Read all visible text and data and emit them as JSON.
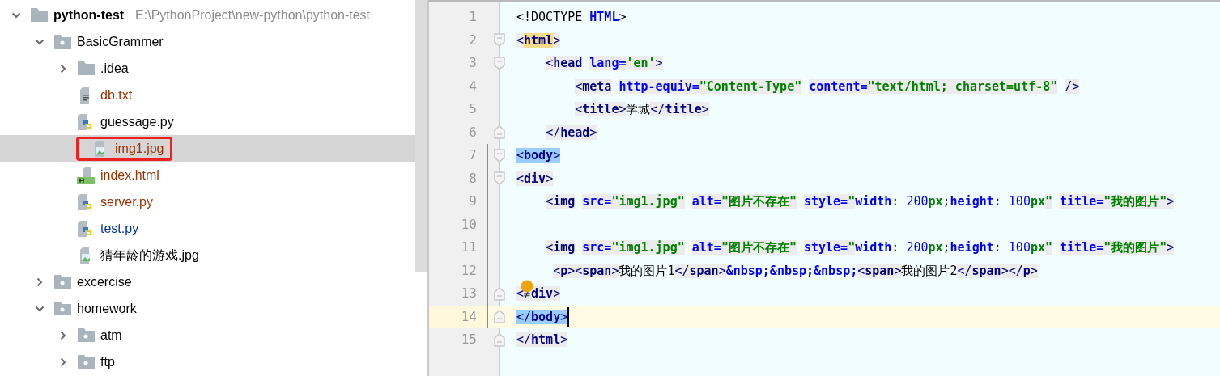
{
  "project_tree": {
    "items": [
      {
        "label": "python-test",
        "kind": "project",
        "path": "E:\\PythonProject\\new-python\\python-test",
        "expanded": true,
        "selected": false,
        "annotated": false,
        "children": [
          {
            "label": "BasicGrammer",
            "kind": "module",
            "expanded": true,
            "selected": false,
            "annotated": false,
            "children": [
              {
                "label": ".idea",
                "kind": "folder",
                "expanded": false,
                "selected": false,
                "annotated": false
              },
              {
                "label": "db.txt",
                "kind": "text",
                "color": "#993300",
                "selected": false,
                "annotated": false
              },
              {
                "label": "guessage.py",
                "kind": "python",
                "color": "#000000",
                "selected": false,
                "annotated": false
              },
              {
                "label": "img1.jpg",
                "kind": "image",
                "color": "#993300",
                "selected": true,
                "annotated": true
              },
              {
                "label": "index.html",
                "kind": "html",
                "color": "#993300",
                "selected": false,
                "annotated": false
              },
              {
                "label": "server.py",
                "kind": "python",
                "color": "#993300",
                "selected": false,
                "annotated": false
              },
              {
                "label": "test.py",
                "kind": "python",
                "color": "#0032a0",
                "selected": false,
                "annotated": false
              },
              {
                "label": "猜年龄的游戏.jpg",
                "kind": "image",
                "color": "#000000",
                "selected": false,
                "annotated": false
              }
            ]
          },
          {
            "label": "excercise",
            "kind": "module",
            "expanded": false,
            "selected": false,
            "annotated": false
          },
          {
            "label": "homework",
            "kind": "module",
            "expanded": true,
            "selected": false,
            "annotated": false,
            "children": [
              {
                "label": "atm",
                "kind": "module",
                "expanded": false,
                "selected": false,
                "annotated": false
              },
              {
                "label": "ftp",
                "kind": "module",
                "expanded": false,
                "selected": false,
                "annotated": false
              }
            ]
          }
        ]
      }
    ]
  },
  "editor": {
    "lines": [
      {
        "number": "1",
        "modified": false,
        "current": false,
        "tokens": [
          {
            "kind": "doctype",
            "text": "<!DOCTYPE "
          },
          {
            "kind": "keyword",
            "text": "HTML"
          },
          {
            "kind": "doctype",
            "text": ">"
          }
        ]
      },
      {
        "number": "2",
        "fold_marker": {
          "kind": "start"
        },
        "modified": false,
        "current": false,
        "tokens": [
          {
            "kind": "bracket",
            "text": "<"
          },
          {
            "kind": "tag",
            "text": "html",
            "matched": true
          },
          {
            "kind": "bracket",
            "text": ">"
          }
        ]
      },
      {
        "number": "3",
        "fold_marker": {
          "kind": "start"
        },
        "modified": false,
        "current": false,
        "tokens": [
          {
            "kind": "bracket",
            "text": "    <"
          },
          {
            "kind": "tag",
            "text": "head"
          },
          {
            "kind": "attr",
            "text": " lang="
          },
          {
            "kind": "value",
            "text": "'en'"
          },
          {
            "kind": "bracket",
            "text": ">"
          }
        ]
      },
      {
        "number": "4",
        "modified": false,
        "current": false,
        "tokens": [
          {
            "kind": "bracket",
            "text": "        <"
          },
          {
            "kind": "tag",
            "text": "meta"
          },
          {
            "kind": "attr",
            "text": " http-equiv="
          },
          {
            "kind": "value",
            "text": "\"Content-Type\""
          },
          {
            "kind": "attr",
            "text": " content="
          },
          {
            "kind": "value",
            "text": "\"text/html; charset=utf-8\""
          },
          {
            "kind": "bracket",
            "text": " />"
          }
        ]
      },
      {
        "number": "5",
        "modified": false,
        "current": false,
        "tokens": [
          {
            "kind": "bracket",
            "text": "        <"
          },
          {
            "kind": "tag",
            "text": "title"
          },
          {
            "kind": "bracket",
            "text": ">"
          },
          {
            "kind": "text",
            "text": "学城"
          },
          {
            "kind": "bracket",
            "text": "</"
          },
          {
            "kind": "tag",
            "text": "title"
          },
          {
            "kind": "bracket",
            "text": ">"
          }
        ]
      },
      {
        "number": "6",
        "fold_marker": {
          "kind": "end"
        },
        "modified": false,
        "current": false,
        "tokens": [
          {
            "kind": "bracket",
            "text": "    </"
          },
          {
            "kind": "tag",
            "text": "head"
          },
          {
            "kind": "bracket",
            "text": ">"
          }
        ]
      },
      {
        "number": "7",
        "fold_marker": {
          "kind": "start"
        },
        "modified": true,
        "current": false,
        "selected_match": true,
        "tokens": [
          {
            "kind": "bracket",
            "text": "<"
          },
          {
            "kind": "tag",
            "text": "body"
          },
          {
            "kind": "bracket",
            "text": ">"
          }
        ]
      },
      {
        "number": "8",
        "fold_marker": {
          "kind": "start"
        },
        "modified": true,
        "current": false,
        "tokens": [
          {
            "kind": "bracket",
            "text": "<"
          },
          {
            "kind": "tag",
            "text": "div"
          },
          {
            "kind": "bracket",
            "text": ">"
          }
        ]
      },
      {
        "number": "9",
        "modified": true,
        "current": false,
        "tokens": [
          {
            "kind": "bracket",
            "text": "    <"
          },
          {
            "kind": "tag",
            "text": "img"
          },
          {
            "kind": "attr",
            "text": " src="
          },
          {
            "kind": "value",
            "text": "\"img1.jpg\""
          },
          {
            "kind": "attr",
            "text": " alt="
          },
          {
            "kind": "value",
            "text": "\"图片不存在\""
          },
          {
            "kind": "attr",
            "text": " style="
          },
          {
            "kind": "value",
            "text": "\""
          },
          {
            "kind": "css-prop",
            "text": "width"
          },
          {
            "kind": "css-punct",
            "text": ": "
          },
          {
            "kind": "css-num",
            "text": "200"
          },
          {
            "kind": "css-unit",
            "text": "px"
          },
          {
            "kind": "css-punct",
            "text": ";"
          },
          {
            "kind": "css-prop",
            "text": "height"
          },
          {
            "kind": "css-punct",
            "text": ": "
          },
          {
            "kind": "css-num",
            "text": "100"
          },
          {
            "kind": "css-unit",
            "text": "px"
          },
          {
            "kind": "value",
            "text": "\""
          },
          {
            "kind": "attr",
            "text": " title="
          },
          {
            "kind": "value",
            "text": "\"我的图片\""
          },
          {
            "kind": "bracket",
            "text": ">"
          }
        ]
      },
      {
        "number": "10",
        "modified": true,
        "current": false
      },
      {
        "number": "11",
        "modified": true,
        "current": false,
        "tokens": [
          {
            "kind": "bracket",
            "text": "    <"
          },
          {
            "kind": "tag",
            "text": "img"
          },
          {
            "kind": "attr",
            "text": " src="
          },
          {
            "kind": "value",
            "text": "\"img1.jpg\""
          },
          {
            "kind": "attr",
            "text": " alt="
          },
          {
            "kind": "value",
            "text": "\"图片不存在\""
          },
          {
            "kind": "attr",
            "text": " style="
          },
          {
            "kind": "value",
            "text": "\""
          },
          {
            "kind": "css-prop",
            "text": "width"
          },
          {
            "kind": "css-punct",
            "text": ": "
          },
          {
            "kind": "css-num",
            "text": "200"
          },
          {
            "kind": "css-unit",
            "text": "px"
          },
          {
            "kind": "css-punct",
            "text": ";"
          },
          {
            "kind": "css-prop",
            "text": "height"
          },
          {
            "kind": "css-punct",
            "text": ": "
          },
          {
            "kind": "css-num",
            "text": "100"
          },
          {
            "kind": "css-unit",
            "text": "px"
          },
          {
            "kind": "value",
            "text": "\""
          },
          {
            "kind": "attr",
            "text": " title="
          },
          {
            "kind": "value",
            "text": "\"我的图片\""
          },
          {
            "kind": "bracket",
            "text": ">"
          }
        ]
      },
      {
        "number": "12",
        "modified": true,
        "current": false,
        "tokens": [
          {
            "kind": "bracket",
            "text": "     <"
          },
          {
            "kind": "tag",
            "text": "p"
          },
          {
            "kind": "bracket",
            "text": "><"
          },
          {
            "kind": "tag",
            "text": "span"
          },
          {
            "kind": "bracket",
            "text": ">"
          },
          {
            "kind": "text",
            "text": "我的图片1"
          },
          {
            "kind": "bracket",
            "text": "</"
          },
          {
            "kind": "tag",
            "text": "span"
          },
          {
            "kind": "bracket",
            "text": ">"
          },
          {
            "kind": "entity",
            "text": "&nbsp;&nbsp;&nbsp;"
          },
          {
            "kind": "bracket",
            "text": "<"
          },
          {
            "kind": "tag",
            "text": "span"
          },
          {
            "kind": "bracket",
            "text": ">"
          },
          {
            "kind": "text",
            "text": "我的图片2"
          },
          {
            "kind": "bracket",
            "text": "</"
          },
          {
            "kind": "tag",
            "text": "span"
          },
          {
            "kind": "bracket",
            "text": "></"
          },
          {
            "kind": "tag",
            "text": "p"
          },
          {
            "kind": "bracket",
            "text": ">"
          }
        ]
      },
      {
        "number": "13",
        "fold_marker": {
          "kind": "end"
        },
        "modified": true,
        "current": false,
        "hint_bulb": true,
        "tokens": [
          {
            "kind": "bracket",
            "text": "</"
          },
          {
            "kind": "tag",
            "text": "div"
          },
          {
            "kind": "bracket",
            "text": ">"
          }
        ]
      },
      {
        "number": "14",
        "fold_marker": {
          "kind": "end"
        },
        "modified": true,
        "current": true,
        "selected_match": true,
        "caret": true,
        "tokens": [
          {
            "kind": "bracket",
            "text": "</"
          },
          {
            "kind": "tag",
            "text": "body"
          },
          {
            "kind": "bracket",
            "text": ">"
          }
        ]
      },
      {
        "number": "15",
        "fold_marker": {
          "kind": "end"
        },
        "modified": false,
        "current": false,
        "tokens": [
          {
            "kind": "bracket",
            "text": "</"
          },
          {
            "kind": "tag",
            "text": "html"
          },
          {
            "kind": "bracket",
            "text": ">"
          }
        ]
      }
    ]
  }
}
